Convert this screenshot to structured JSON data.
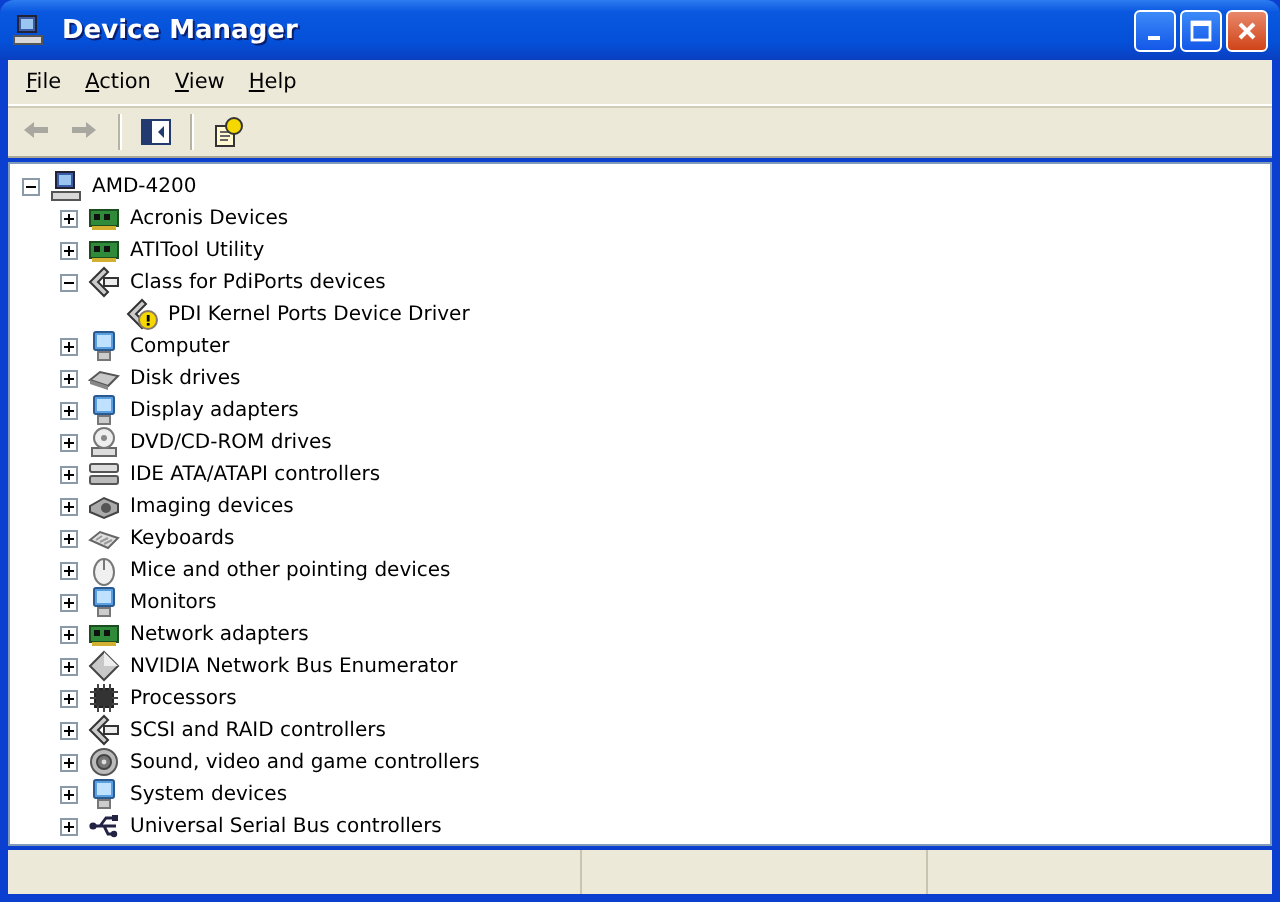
{
  "window": {
    "title": "Device Manager"
  },
  "menu": [
    "File",
    "Action",
    "View",
    "Help"
  ],
  "toolbar": [
    {
      "kind": "back",
      "disabled": true
    },
    {
      "kind": "forward",
      "disabled": true
    },
    {
      "kind": "tree"
    },
    {
      "kind": "help"
    }
  ],
  "tree": [
    {
      "label": "AMD-4200",
      "kind": "computer",
      "expanded": true,
      "children": [
        {
          "label": "Acronis Devices",
          "kind": "board",
          "expanded": false
        },
        {
          "label": "ATITool Utility",
          "kind": "board",
          "expanded": false
        },
        {
          "label": "Class for PdiPorts devices",
          "kind": "port",
          "expanded": true,
          "children": [
            {
              "label": "PDI Kernel Ports Device Driver",
              "kind": "warning"
            }
          ]
        },
        {
          "label": "Computer",
          "kind": "monitor",
          "expanded": false
        },
        {
          "label": "Disk drives",
          "kind": "disk",
          "expanded": false
        },
        {
          "label": "Display adapters",
          "kind": "monitor",
          "expanded": false
        },
        {
          "label": "DVD/CD-ROM drives",
          "kind": "optical",
          "expanded": false
        },
        {
          "label": "IDE ATA/ATAPI controllers",
          "kind": "controller",
          "expanded": false
        },
        {
          "label": "Imaging devices",
          "kind": "camera",
          "expanded": false
        },
        {
          "label": "Keyboards",
          "kind": "keyboard",
          "expanded": false
        },
        {
          "label": "Mice and other pointing devices",
          "kind": "mouse",
          "expanded": false
        },
        {
          "label": "Monitors",
          "kind": "monitor",
          "expanded": false
        },
        {
          "label": "Network adapters",
          "kind": "board",
          "expanded": false
        },
        {
          "label": "NVIDIA Network Bus Enumerator",
          "kind": "diamond",
          "expanded": false
        },
        {
          "label": "Processors",
          "kind": "chip",
          "expanded": false
        },
        {
          "label": "SCSI and RAID controllers",
          "kind": "port",
          "expanded": false
        },
        {
          "label": "Sound, video and game controllers",
          "kind": "speaker",
          "expanded": false
        },
        {
          "label": "System devices",
          "kind": "monitor",
          "expanded": false
        },
        {
          "label": "Universal Serial Bus controllers",
          "kind": "usb",
          "expanded": false
        }
      ]
    }
  ]
}
